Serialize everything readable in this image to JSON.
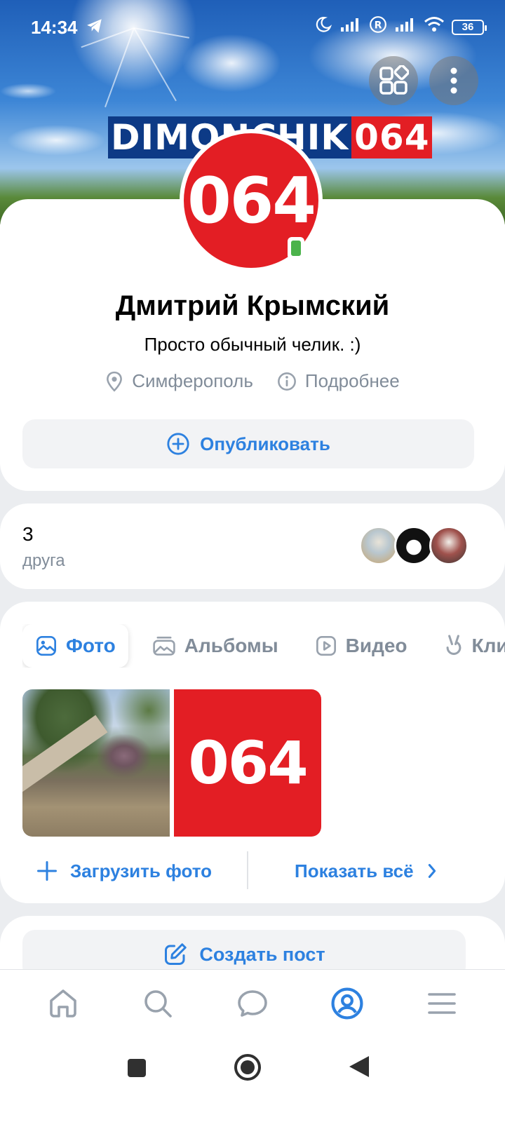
{
  "status_bar": {
    "time": "14:34",
    "battery": "36"
  },
  "cover": {
    "banner_left": "DIMONCHIK",
    "banner_right": "064"
  },
  "profile": {
    "avatar_text": "064",
    "name": "Дмитрий Крымский",
    "status": "Просто обычный челик. :)",
    "city": "Симферополь",
    "more": "Подробнее",
    "publish_label": "Опубликовать"
  },
  "friends": {
    "count": "3",
    "label": "друга"
  },
  "media": {
    "tabs": [
      {
        "label": "Фото",
        "icon": "image-icon"
      },
      {
        "label": "Альбомы",
        "icon": "albums-icon"
      },
      {
        "label": "Видео",
        "icon": "video-icon"
      },
      {
        "label": "Клипы",
        "icon": "clips-icon"
      }
    ],
    "photo2_text": "064",
    "upload_label": "Загрузить фото",
    "show_all_label": "Показать всё"
  },
  "post": {
    "create_label": "Создать пост"
  },
  "colors": {
    "accent": "#2d81e0",
    "brand_red": "#e31e24",
    "brand_blue": "#0d3a86",
    "secondary_text": "#818c99",
    "online": "#4bb34b"
  },
  "bottom_nav": [
    {
      "name": "home",
      "icon": "home-icon"
    },
    {
      "name": "search",
      "icon": "search-icon"
    },
    {
      "name": "messages",
      "icon": "chat-icon"
    },
    {
      "name": "profile",
      "icon": "profile-icon",
      "active": true
    },
    {
      "name": "menu",
      "icon": "menu-icon"
    }
  ]
}
